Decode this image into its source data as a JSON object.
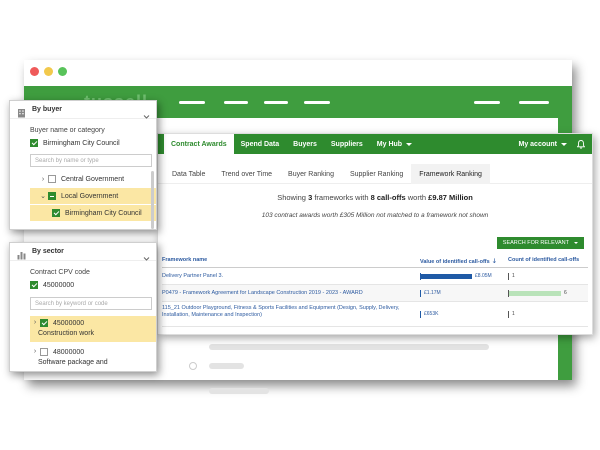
{
  "back_window": {
    "logo": "tussell"
  },
  "main_nav": {
    "tabs": [
      "Contract Awards",
      "Spend Data",
      "Buyers",
      "Suppliers",
      "My Hub"
    ],
    "active_tab": "Contract Awards",
    "account_label": "My account"
  },
  "sub_tabs": {
    "items": [
      "Data Table",
      "Trend over Time",
      "Buyer Ranking",
      "Supplier Ranking",
      "Framework Ranking"
    ],
    "active": "Framework Ranking"
  },
  "summary": {
    "prefix": "Showing",
    "frameworks_count": "3",
    "mid1": "frameworks with",
    "calloffs_count": "8 call-offs",
    "mid2": "worth",
    "total_value": "£9.87 Million",
    "unmatched": "103 contract awards worth £305 Million not matched to a framework not shown"
  },
  "filter_button": {
    "label": "SEARCH FOR RELEVANT"
  },
  "table": {
    "col_name": "Framework name",
    "col_value": "Value of identified call-offs",
    "col_count": "Count of identified call-offs",
    "rows": [
      {
        "name": "Delivery Partner Panel 3.",
        "value_label": "£8.05M",
        "value_frac": 0.82,
        "count": "1",
        "count_frac": 0.0
      },
      {
        "name": "P0479 - Framework Agreement for Landscape Construction 2019 - 2023 - AWARD",
        "value_label": "£1.17M",
        "value_frac": 0.0,
        "count": "6",
        "count_frac": 0.92
      },
      {
        "name": "115_21 Outdoor Playground, Fitness & Sports Facilities and Equipment (Design, Supply, Delivery, Installation, Maintenance and Inspection)",
        "value_label": "£653K",
        "value_frac": 0.0,
        "count": "1",
        "count_frac": 0.0
      }
    ]
  },
  "buyer_panel": {
    "title": "By buyer",
    "field_label": "Buyer name or category",
    "selected": "Birmingham City Council",
    "search_placeholder": "Search by name or type",
    "tree": [
      {
        "label": "Central Government",
        "state": "unchecked",
        "expander": "›",
        "highlight": false
      },
      {
        "label": "Local Government",
        "state": "partial",
        "expander": "⌄",
        "highlight": true
      },
      {
        "label": "Birmingham City Council",
        "state": "checked",
        "expander": "",
        "highlight": true
      }
    ]
  },
  "sector_panel": {
    "title": "By sector",
    "field_label": "Contract CPV code",
    "selected": "45000000",
    "search_placeholder": "Search by keyword or code",
    "tree": [
      {
        "code": "45000000",
        "label": "Construction work",
        "state": "checked",
        "highlight": true
      },
      {
        "code": "48000000",
        "label": "Software package and",
        "state": "unchecked",
        "highlight": false
      }
    ]
  },
  "colors": {
    "brand_green": "#2e8b2e",
    "bar_blue": "#1f5aa6",
    "highlight": "#fbe7a4"
  }
}
